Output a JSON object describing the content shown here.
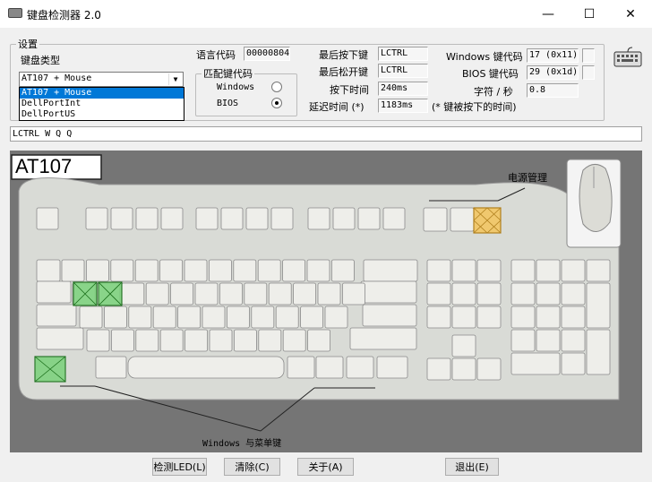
{
  "window": {
    "title": "键盘检测器 2.0",
    "minimize": "—",
    "maximize": "☐",
    "close": "✕"
  },
  "settings": {
    "legend": "设置",
    "kb_type_label": "键盘类型",
    "kb_type_value": "AT107 + Mouse",
    "options": [
      "AT107 + Mouse",
      "DellPortInt",
      "DellPortUS"
    ],
    "lang_label": "语言代码",
    "lang_value": "00000804",
    "match_legend": "匹配键代码",
    "opt_windows": "Windows",
    "opt_bios": "BIOS",
    "selected_match": "BIOS",
    "last_press_label": "最后按下键",
    "last_press_value": "LCTRL",
    "last_release_label": "最后松开键",
    "last_release_value": "LCTRL",
    "press_time_label": "按下时间",
    "press_time_value": "240ms",
    "delay_label": "延迟时间 (*)",
    "delay_value": "1183ms",
    "delay_note": "(* 键被按下的时间)",
    "win_code_label": "Windows 键代码",
    "win_code_value": "17 (0x11)",
    "bios_code_label": "BIOS 键代码",
    "bios_code_value": "29 (0x1d)",
    "rate_label": "字符 / 秒",
    "rate_value": "0.8"
  },
  "log": "LCTRL W Q Q",
  "keyboard": {
    "model": "AT107",
    "power_label": "电源管理",
    "win_menu_label": "Windows 与菜单键"
  },
  "buttons": {
    "led": "检测LED(L)",
    "clear": "清除(C)",
    "about": "关于(A)",
    "exit": "退出(E)"
  }
}
